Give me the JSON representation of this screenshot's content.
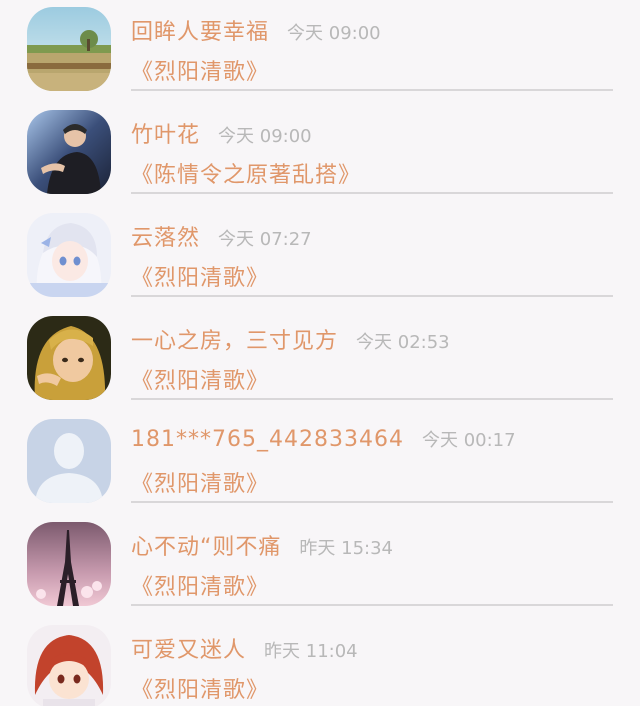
{
  "comments": [
    {
      "name": "回眸人要幸福",
      "time": "今天 09:00",
      "work": "《烈阳清歌》",
      "avatar": "avatar-landscape"
    },
    {
      "name": "竹叶花",
      "time": "今天 09:00",
      "work": "《陈情令之原著乱搭》",
      "avatar": "avatar-man-night"
    },
    {
      "name": "云落然",
      "time": "今天 07:27",
      "work": "《烈阳清歌》",
      "avatar": "avatar-anime-white-hair"
    },
    {
      "name": "一心之房，三寸见方",
      "time": "今天 02:53",
      "work": "《烈阳清歌》",
      "avatar": "avatar-blonde-girl"
    },
    {
      "name": "181***765_442833464",
      "time": "今天 00:17",
      "work": "《烈阳清歌》",
      "avatar": "avatar-default-person"
    },
    {
      "name": "心不动“则不痛",
      "time": "昨天 15:34",
      "work": "《烈阳清歌》",
      "avatar": "avatar-eiffel-tower"
    },
    {
      "name": "可爱又迷人",
      "time": "昨天 11:04",
      "work": "《烈阳清歌》",
      "avatar": "avatar-anime-redhead"
    }
  ],
  "colors": {
    "accent": "#e0976a",
    "time": "#b8b8b8",
    "divider": "#d9d7d9",
    "background": "#f8f6f8"
  }
}
